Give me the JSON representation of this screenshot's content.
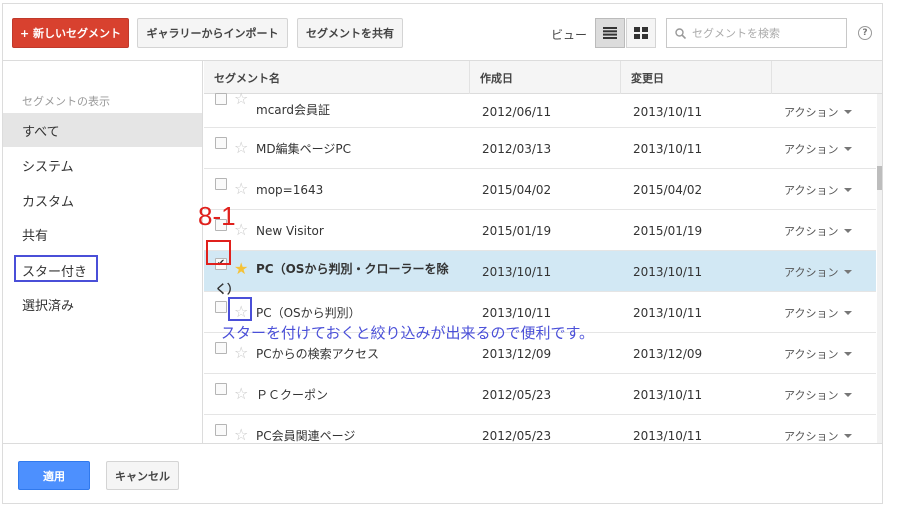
{
  "toolbar": {
    "new_segment": "+ 新しいセグメント",
    "import_gallery": "ギャラリーからインポート",
    "share_segment": "セグメントを共有",
    "view_label": "ビュー",
    "search_placeholder": "セグメントを検索",
    "help": "?"
  },
  "sidebar": {
    "heading": "セグメントの表示",
    "items": [
      {
        "label": "すべて"
      },
      {
        "label": "システム"
      },
      {
        "label": "カスタム"
      },
      {
        "label": "共有"
      },
      {
        "label": "スター付き"
      },
      {
        "label": "選択済み"
      }
    ]
  },
  "table": {
    "columns": [
      "セグメント名",
      "作成日",
      "変更日"
    ],
    "action_label": "アクション",
    "rows": [
      {
        "name": "mcard会員証",
        "created": "2012/06/11",
        "modified": "2013/10/11",
        "checked": false,
        "starred": false
      },
      {
        "name": "MD編集ページPC",
        "created": "2012/03/13",
        "modified": "2013/10/11",
        "checked": false,
        "starred": false
      },
      {
        "name": "mop=1643",
        "created": "2015/04/02",
        "modified": "2015/04/02",
        "checked": false,
        "starred": false
      },
      {
        "name": "New Visitor",
        "created": "2015/01/19",
        "modified": "2015/01/19",
        "checked": false,
        "starred": false
      },
      {
        "name": "PC（OSから判別・クローラーを除く）",
        "created": "2013/10/11",
        "modified": "2013/10/11",
        "checked": true,
        "starred": true
      },
      {
        "name": "PC（OSから判別）",
        "created": "2013/10/11",
        "modified": "2013/10/11",
        "checked": false,
        "starred": false
      },
      {
        "name": "PCからの検索アクセス",
        "created": "2013/12/09",
        "modified": "2013/12/09",
        "checked": false,
        "starred": false
      },
      {
        "name": "ＰＣクーポン",
        "created": "2012/05/23",
        "modified": "2013/10/11",
        "checked": false,
        "starred": false
      },
      {
        "name": "PC会員関連ページ",
        "created": "2012/05/23",
        "modified": "2013/10/11",
        "checked": false,
        "starred": false
      }
    ]
  },
  "footer": {
    "apply": "適用",
    "cancel": "キャンセル"
  },
  "annotations": {
    "step_label": "8-1",
    "note": "スターを付けておくと絞り込みが出来るので便利です。"
  },
  "colors": {
    "primary_red": "#d8412f",
    "apply_blue": "#4d90fe",
    "selected_row": "#d2e8f4",
    "annotation_blue": "#4a4fd8",
    "annotation_red": "#e0201c",
    "star_on": "#f5c238"
  }
}
